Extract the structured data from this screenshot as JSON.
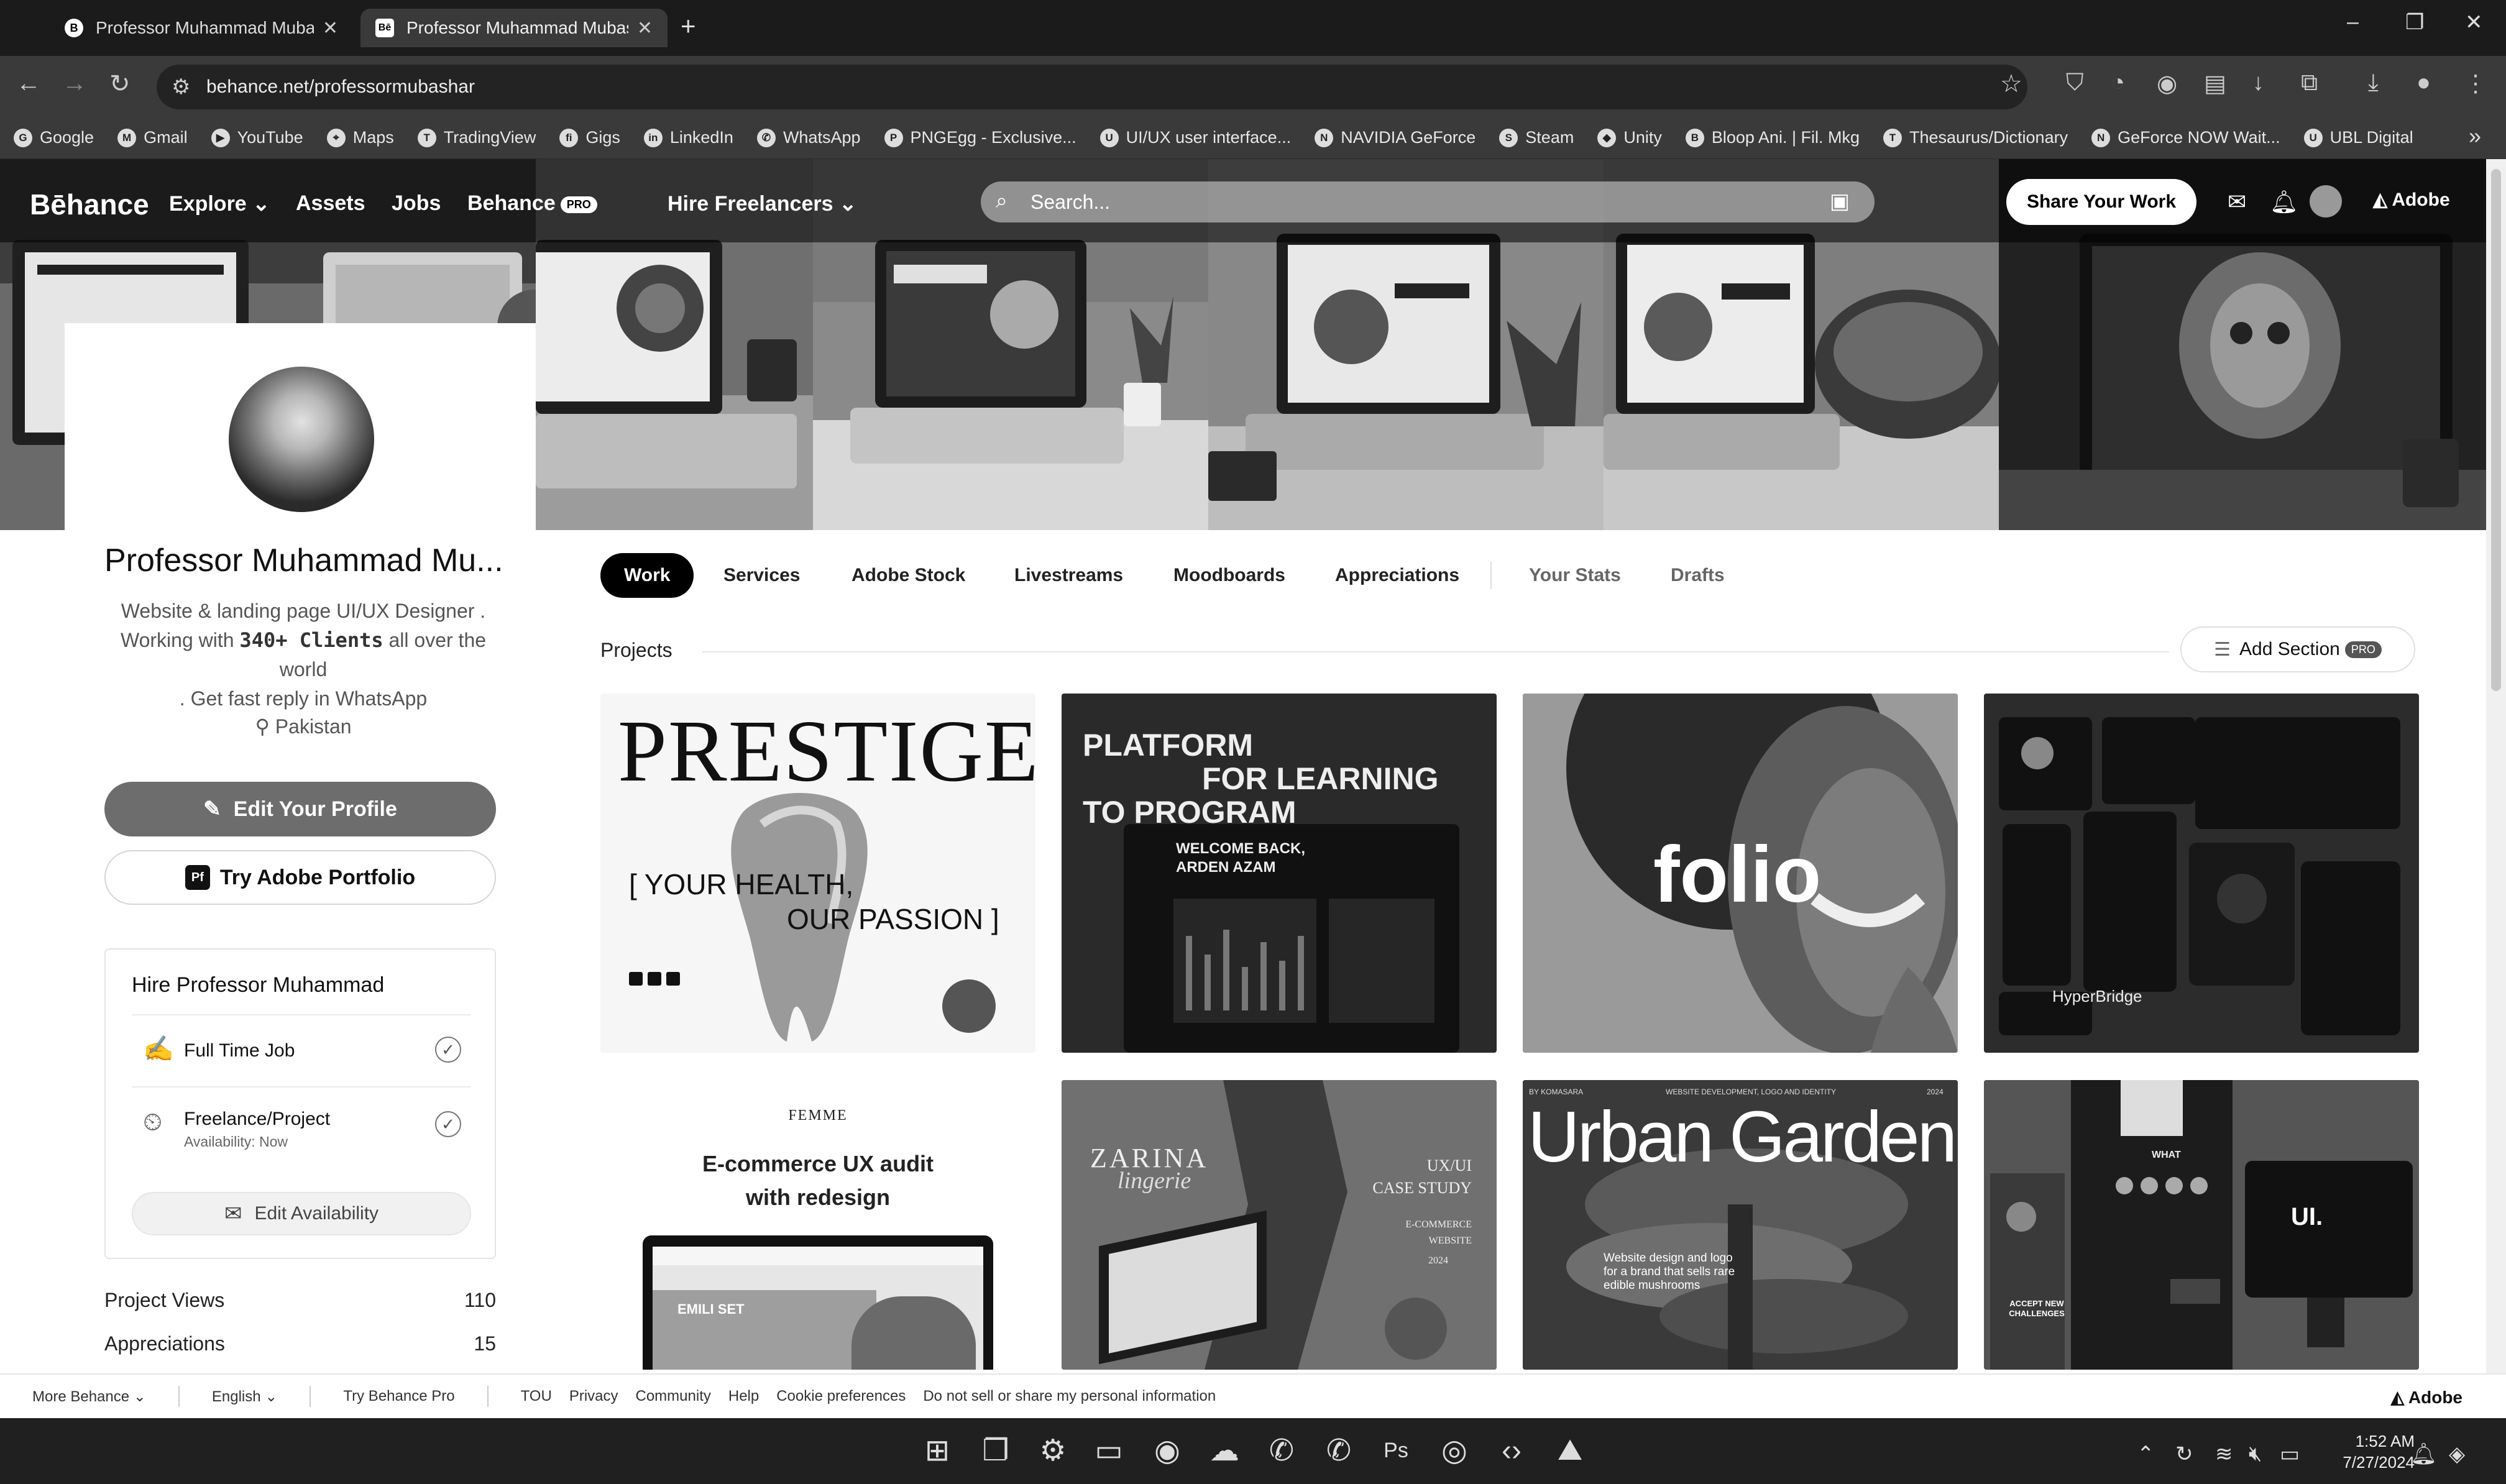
{
  "browser": {
    "tabs": [
      {
        "title": "Professor Muhammad Mubasha",
        "favicon": "B"
      },
      {
        "title": "Professor Muhammad Mubasha",
        "favicon": "Bē"
      }
    ],
    "url": "behance.net/professormubashar",
    "bookmarks": [
      {
        "label": "Google",
        "icon": "G"
      },
      {
        "label": "Gmail",
        "icon": "M"
      },
      {
        "label": "YouTube",
        "icon": "▶"
      },
      {
        "label": "Maps",
        "icon": "⌖"
      },
      {
        "label": "TradingView",
        "icon": "T"
      },
      {
        "label": "Gigs",
        "icon": "fi"
      },
      {
        "label": "LinkedIn",
        "icon": "in"
      },
      {
        "label": "WhatsApp",
        "icon": "✆"
      },
      {
        "label": "PNGEgg - Exclusive...",
        "icon": "P"
      },
      {
        "label": "UI/UX user interface...",
        "icon": "U"
      },
      {
        "label": "NAVIDIA GeForce",
        "icon": "N"
      },
      {
        "label": "Steam",
        "icon": "S"
      },
      {
        "label": "Unity",
        "icon": "◆"
      },
      {
        "label": "Bloop Ani. | Fil. Mkg",
        "icon": "B"
      },
      {
        "label": "Thesaurus/Dictionary",
        "icon": "T"
      },
      {
        "label": "GeForce NOW Wait...",
        "icon": "N"
      },
      {
        "label": "UBL Digital",
        "icon": "U"
      }
    ]
  },
  "topnav": {
    "logo": "Bēhance",
    "explore": "Explore",
    "assets": "Assets",
    "jobs": "Jobs",
    "behance_pro": "Behance",
    "pro_badge": "PRO",
    "hire": "Hire Freelancers",
    "search_placeholder": "Search...",
    "share": "Share Your Work",
    "adobe": "Adobe"
  },
  "profile": {
    "name": "Professor Muhammad Mu...",
    "bio_line1": "Website & landing page UI/UX Designer .",
    "bio_line2_pre": "Working with ",
    "bio_line2_bold": "340+ Clients",
    "bio_line2_post": " all over the world",
    "bio_line3": ". Get fast reply in WhatsApp",
    "location": "Pakistan",
    "edit_button": "Edit Your Profile",
    "portfolio_button": "Try Adobe Portfolio",
    "portfolio_badge": "Pf",
    "hire_title": "Hire Professor Muhammad",
    "full_time": "Full Time Job",
    "freelance": "Freelance/Project",
    "availability": "Availability: Now",
    "edit_availability": "Edit Availability",
    "stats": [
      {
        "label": "Project Views",
        "value": "110"
      },
      {
        "label": "Appreciations",
        "value": "15"
      }
    ]
  },
  "tabs": [
    "Work",
    "Services",
    "Adobe Stock",
    "Livestreams",
    "Moodboards",
    "Appreciations",
    "Your Stats",
    "Drafts"
  ],
  "projects": {
    "label": "Projects",
    "add_section": "Add Section",
    "pro_badge": "PRO",
    "thumbs": {
      "t1_title": "PRESTIGE",
      "t1_line1": "[ YOUR HEALTH,",
      "t1_line2": "OUR PASSION ]",
      "t2_title1": "PLATFORM",
      "t2_title2": "FOR LEARNING",
      "t2_title3": "TO PROGRAM",
      "t2_welcome": "WELCOME BACK,",
      "t2_name": "ARDEN AZAM",
      "t3_word": "folio",
      "t4_brand": "HyperBridge",
      "t5_brand": "FEMME",
      "t5_title1": "E-commerce UX audit",
      "t5_title2": "with redesign",
      "t5_screen": "EMILI SET",
      "t6_brand": "ZARINA",
      "t6_script": "lingerie",
      "t6_case1": "UX/UI",
      "t6_case2": "CASE STUDY",
      "t6_case3": "E-COMMERCE",
      "t6_case4": "WEBSITE",
      "t6_year": "2024",
      "t7_top": "BY KOMASARA",
      "t7_mid": "WEBSITE DEVELOPMENT, LOGO AND IDENTITY",
      "t7_year": "2024",
      "t7_title": "Urban Garden",
      "t7_desc": "Website design and logo for a brand that sells rare edible mushrooms",
      "t8_ui": "UI.",
      "t8_what": "WHAT",
      "t8_accept": "ACCEPT NEW CHALLENGES"
    }
  },
  "footer": {
    "more": "More Behance",
    "english": "English",
    "try_pro": "Try Behance Pro",
    "links": [
      "TOU",
      "Privacy",
      "Community",
      "Help",
      "Cookie preferences",
      "Do not sell or share my personal information"
    ],
    "adobe": "Adobe"
  },
  "taskbar": {
    "time": "1:52 AM",
    "date": "7/27/2024"
  }
}
